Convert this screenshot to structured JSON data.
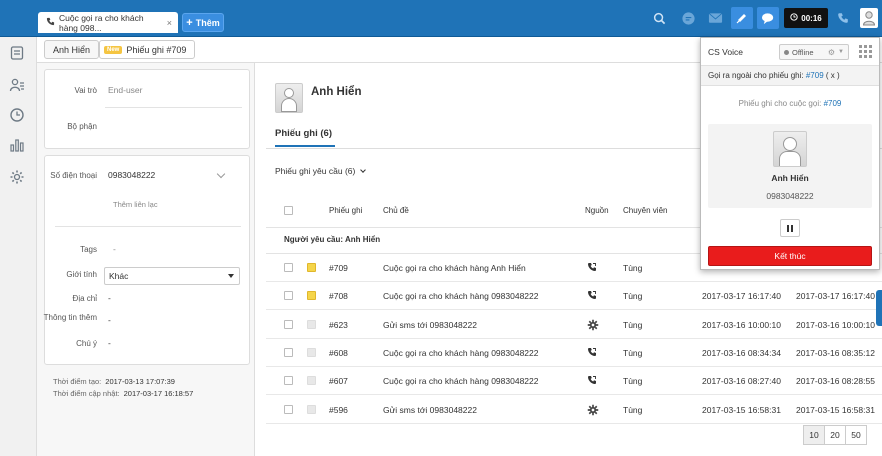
{
  "topbar": {
    "tab_title": "Cuộc gọi ra cho khách hàng 098...",
    "tab_close": "×",
    "add_label": "Thêm",
    "timer": "00:16"
  },
  "subheader": {
    "crumb_user": "Anh Hiển",
    "crumb_badge": "New",
    "crumb_ticket": "Phiếu ghi #709"
  },
  "user_panel": {
    "role_label": "Vai trò",
    "role_placeholder": "End-user",
    "dept_label": "Bộ phận",
    "phone_label": "Số điện thoại",
    "phone_value": "0983048222",
    "add_contact": "Thêm liên lạc",
    "tags_label": "Tags",
    "tags_value": "-",
    "gender_label": "Giới tính",
    "gender_value": "Khác",
    "address_label": "Địa chỉ",
    "address_value": "-",
    "info_label": "Thông tin thêm",
    "info_value": "-",
    "note_label": "Chú ý",
    "note_value": "-",
    "created_label": "Thời điểm tạo:",
    "created_value": "2017-03-13 17:07:39",
    "updated_label": "Thời điểm cập nhật:",
    "updated_value": "2017-03-17 16:18:57"
  },
  "main": {
    "user_name": "Anh Hiển",
    "tab_label": "Phiếu ghi (6)",
    "view_label": "Phiếu ghi yêu cầu (6)",
    "columns": {
      "ticket": "Phiếu ghi",
      "subject": "Chủ đề",
      "source": "Nguồn",
      "agent": "Chuyên viên"
    },
    "group_label": "Người yêu cầu: Anh Hiển",
    "rows": [
      {
        "id": "#709",
        "subject": "Cuộc gọi ra cho khách hàng Anh Hiển",
        "source_icon": "phone-icon",
        "agent": "Tùng",
        "created": "",
        "updated": "",
        "status_color": "#f5d54a"
      },
      {
        "id": "#708",
        "subject": "Cuộc gọi ra cho khách hàng 0983048222",
        "source_icon": "phone-icon",
        "agent": "Tùng",
        "created": "2017-03-17 16:17:40",
        "updated": "2017-03-17 16:17:40",
        "status_color": "#f5d54a"
      },
      {
        "id": "#623",
        "subject": "Gửi sms tới 0983048222",
        "source_icon": "gear-icon",
        "agent": "Tùng",
        "created": "2017-03-16 10:00:10",
        "updated": "2017-03-16 10:00:10",
        "status_color": "#e8e8e8"
      },
      {
        "id": "#608",
        "subject": "Cuộc gọi ra cho khách hàng 0983048222",
        "source_icon": "phone-icon",
        "agent": "Tùng",
        "created": "2017-03-16 08:34:34",
        "updated": "2017-03-16 08:35:12",
        "status_color": "#e8e8e8"
      },
      {
        "id": "#607",
        "subject": "Cuộc gọi ra cho khách hàng 0983048222",
        "source_icon": "phone-icon",
        "agent": "Tùng",
        "created": "2017-03-16 08:27:40",
        "updated": "2017-03-16 08:28:55",
        "status_color": "#e8e8e8"
      },
      {
        "id": "#596",
        "subject": "Gửi sms tới 0983048222",
        "source_icon": "gear-icon",
        "agent": "Tùng",
        "created": "2017-03-15 16:58:31",
        "updated": "2017-03-15 16:58:31",
        "status_color": "#e8e8e8"
      }
    ],
    "pager": [
      "10",
      "20",
      "50"
    ]
  },
  "voice": {
    "title": "CS Voice",
    "status": "Offline",
    "call_prefix": "Gọi ra ngoài cho phiếu ghi:",
    "call_ticket": "#709",
    "call_suffix": "( x )",
    "note_prefix": "Phiếu ghi cho cuộc gọi:",
    "note_ticket": "#709",
    "caller_name": "Anh Hiển",
    "caller_phone": "0983048222",
    "end_label": "Kết thúc"
  },
  "colors": {
    "brand": "#1f73b7",
    "end_call": "#e91c1c",
    "new_badge": "#f5c542"
  }
}
